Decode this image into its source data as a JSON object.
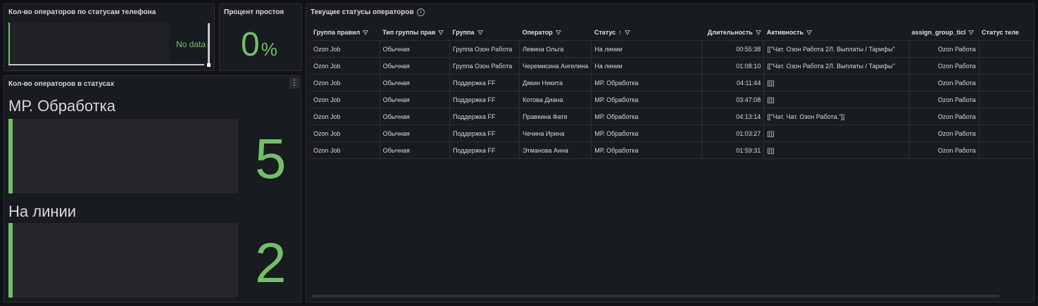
{
  "panel_phone": {
    "title": "Кол-во операторов по статусам телефона",
    "nodata": "No data"
  },
  "panel_idle": {
    "title": "Процент простоя",
    "value": "0",
    "unit": "%"
  },
  "panel_statuses": {
    "title": "Кол-во операторов в статусах",
    "menu_icon": "more-vertical-icon",
    "stats": [
      {
        "label": "МР. Обработка",
        "value": "5"
      },
      {
        "label": "На линии",
        "value": "2"
      }
    ]
  },
  "panel_table": {
    "title": "Текущие статусы операторов",
    "info_icon": "info-icon",
    "columns": [
      {
        "label": "Группа правил",
        "shown": "Группа правил"
      },
      {
        "label": "Тип группы прав",
        "shown": "Тип группы прав"
      },
      {
        "label": "Группа",
        "shown": "Группа"
      },
      {
        "label": "Оператор",
        "shown": "Оператор"
      },
      {
        "label": "Статус",
        "shown": "Статус"
      },
      {
        "label": "Длительность",
        "shown": "Длительность"
      },
      {
        "label": "Активность",
        "shown": "Активность"
      },
      {
        "label": "assign_group_ticket",
        "shown": "assign_group_ticl"
      },
      {
        "label": "Статус телефона",
        "shown": "Статус теле"
      }
    ],
    "sort_indicator": "↑",
    "rows": [
      [
        "Ozon Job",
        "Обычная",
        "Группа Озон Работа",
        "Левина Ольга",
        "На линии",
        "00:55:38",
        "[[\"Чат. Озон Работа 2Л. Выплаты / Тарифы\"",
        "Ozon Работа",
        ""
      ],
      [
        "Ozon Job",
        "Обычная",
        "Группа Озон Работа",
        "Черемисина Ангелина",
        "На линии",
        "01:08:10",
        "[[\"Чат. Озон Работа 2Л. Выплаты / Тарифы\"",
        "Ozon Работа",
        ""
      ],
      [
        "Ozon Job",
        "Обычная",
        "Поддержка FF",
        "Дякин Никита",
        "МР. Обработка",
        "04:11:44",
        "[[]]",
        "Ozon Работа",
        ""
      ],
      [
        "Ozon Job",
        "Обычная",
        "Поддержка FF",
        "Котова Диана",
        "МР. Обработка",
        "03:47:08",
        "[[]]",
        "Ozon Работа",
        ""
      ],
      [
        "Ozon Job",
        "Обычная",
        "Поддержка FF",
        "Правкина Фатя",
        "МР. Обработка",
        "04:13:14",
        "[[\"Чат. Чат. Озон Работа.\"]]",
        "Ozon Работа",
        ""
      ],
      [
        "Ozon Job",
        "Обычная",
        "Поддержка FF",
        "Чечина Ирина",
        "МР. Обработка",
        "01:03:27",
        "[[]]",
        "Ozon Работа",
        ""
      ],
      [
        "Ozon Job",
        "Обычная",
        "Поддержка FF",
        "Этманова Анна",
        "МР. Обработка",
        "01:59:31",
        "[[]]",
        "Ozon Работа",
        ""
      ]
    ]
  }
}
